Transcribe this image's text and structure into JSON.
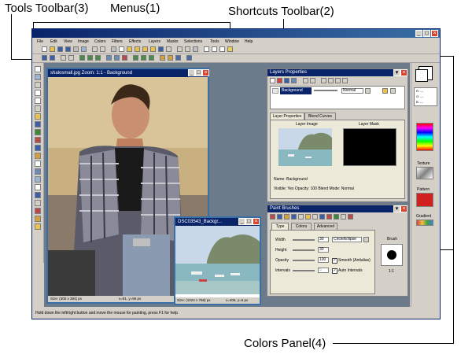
{
  "annotations": {
    "tools_toolbar": "Tools Toolbar(3)",
    "menus": "Menus(1)",
    "shortcuts_toolbar": "Shortcuts Toolbar(2)",
    "colors_panel": "Colors Panel(4)"
  },
  "menu": {
    "items": [
      "File",
      "Edit",
      "View",
      "Image",
      "Colors",
      "Filters",
      "Effects",
      "Layers",
      "Masks",
      "Selections",
      "Tools",
      "Window",
      "Help"
    ]
  },
  "doc_main": {
    "title": "shalosmall.jpg  Zoom: 1:1 - Background",
    "size": "Size: (300 x 384) px",
    "pos": "x=91, y=96 px"
  },
  "doc_small": {
    "title": "DSC03543_Backgr...",
    "size": "Size: (1024 x 768) px",
    "pos": "x=406, y=6 px"
  },
  "layers": {
    "title": "Layers Properties",
    "layer_name": "Background",
    "blend": "Normal",
    "tab_layer_props": "Layer Properties",
    "tab_blend_curves": "Blend Curves",
    "layer_image_label": "Layer Image",
    "layer_mask_label": "Layer Mask",
    "name_line": "Name: Background",
    "props_line": "Visible: Yes   Opacity: 100   Blend Mode: Normal"
  },
  "brushes": {
    "title": "Paint Brushes",
    "tab_type": "Type",
    "tab_colors": "Colors",
    "tab_advanced": "Advanced",
    "width_label": "Width",
    "width_value": "30",
    "shape_value": "Circle/Ellipse",
    "height_label": "Height",
    "height_value": "30",
    "opacity_label": "Opacity",
    "opacity_value": "100",
    "smooth_label": "Smooth (Antialias)",
    "intervals_label": "Intervals",
    "intervals_value": "5",
    "auto_intervals_label": "Auto Intervals",
    "brush_label": "Brush",
    "ratio_label": "1:1"
  },
  "colors_panel": {
    "readout_r": "R: ---",
    "readout_g": "G: ---",
    "readout_b": "B: ---",
    "texture_label": "Texture",
    "pattern_label": "Pattern",
    "gradient_label": "Gradient"
  },
  "status": {
    "text": "Hold down the left/right button and move the mouse for painting, press F1 for help"
  }
}
